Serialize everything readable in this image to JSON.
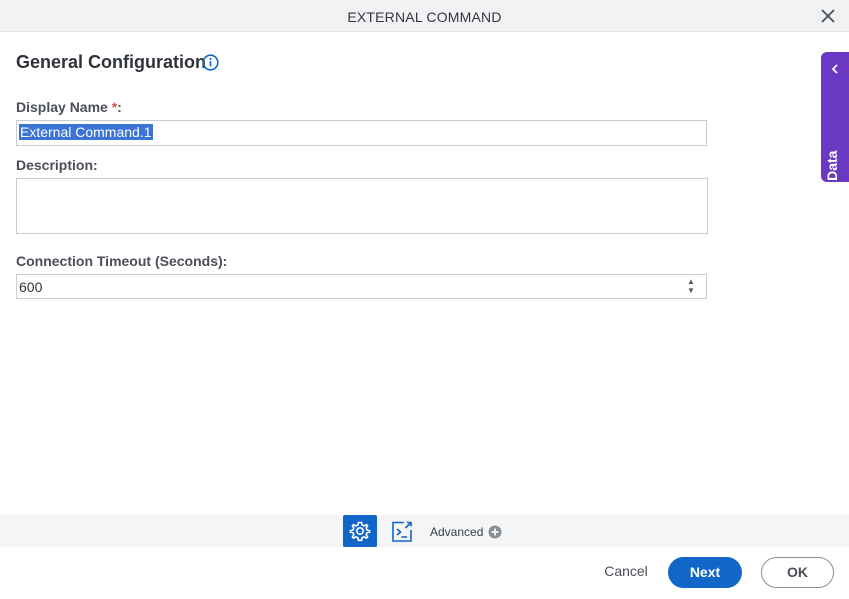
{
  "dialog": {
    "title": "EXTERNAL COMMAND"
  },
  "section": {
    "title": "General Configuration"
  },
  "fields": {
    "display_name": {
      "label": "Display Name",
      "required_mark": "*",
      "suffix": ":",
      "value": "External Command.1"
    },
    "description": {
      "label": "Description:",
      "value": ""
    },
    "timeout": {
      "label": "Connection Timeout (Seconds):",
      "value": "600"
    }
  },
  "side_panel": {
    "label": "App Data"
  },
  "footer": {
    "advanced_label": "Advanced",
    "cancel_label": "Cancel",
    "next_label": "Next",
    "ok_label": "OK"
  },
  "colors": {
    "primary": "#1266c8",
    "side_tab": "#6a38c2",
    "required": "#d9534f"
  }
}
